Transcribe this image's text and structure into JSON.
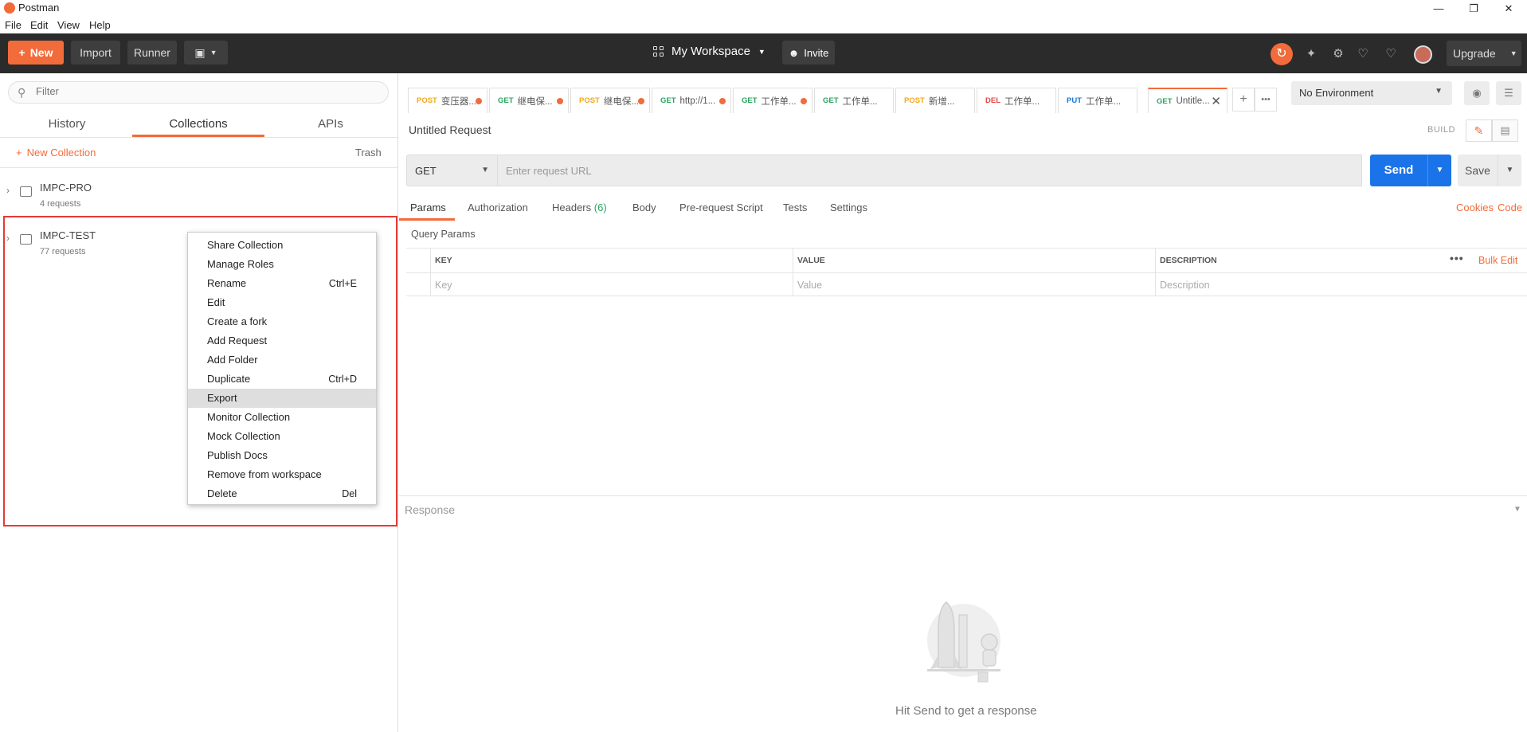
{
  "window": {
    "title": "Postman",
    "menu": [
      "File",
      "Edit",
      "View",
      "Help"
    ]
  },
  "header": {
    "new_label": "New",
    "import_label": "Import",
    "runner_label": "Runner",
    "workspace": "My Workspace",
    "invite_label": "Invite",
    "upgrade_label": "Upgrade"
  },
  "sidebar": {
    "filter_placeholder": "Filter",
    "tabs": [
      "History",
      "Collections",
      "APIs"
    ],
    "new_collection": "New Collection",
    "trash": "Trash",
    "collections": [
      {
        "name": "IMPC-PRO",
        "count": "4 requests"
      },
      {
        "name": "IMPC-TEST",
        "count": "77 requests"
      }
    ]
  },
  "context_menu": [
    {
      "label": "Share Collection",
      "shortcut": ""
    },
    {
      "label": "Manage Roles",
      "shortcut": ""
    },
    {
      "label": "Rename",
      "shortcut": "Ctrl+E"
    },
    {
      "label": "Edit",
      "shortcut": ""
    },
    {
      "label": "Create a fork",
      "shortcut": ""
    },
    {
      "label": "Add Request",
      "shortcut": ""
    },
    {
      "label": "Add Folder",
      "shortcut": ""
    },
    {
      "label": "Duplicate",
      "shortcut": "Ctrl+D"
    },
    {
      "label": "Export",
      "shortcut": ""
    },
    {
      "label": "Monitor Collection",
      "shortcut": ""
    },
    {
      "label": "Mock Collection",
      "shortcut": ""
    },
    {
      "label": "Publish Docs",
      "shortcut": ""
    },
    {
      "label": "Remove from workspace",
      "shortcut": ""
    },
    {
      "label": "Delete",
      "shortcut": "Del"
    }
  ],
  "request_tabs": [
    {
      "method": "POST",
      "title": "变压器..."
    },
    {
      "method": "GET",
      "title": "继电保..."
    },
    {
      "method": "POST",
      "title": "继电保..."
    },
    {
      "method": "GET",
      "title": "http://1..."
    },
    {
      "method": "GET",
      "title": "工作单..."
    },
    {
      "method": "GET",
      "title": "工作单..."
    },
    {
      "method": "POST",
      "title": "新增..."
    },
    {
      "method": "DEL",
      "title": "工作单..."
    },
    {
      "method": "PUT",
      "title": "工作单..."
    },
    {
      "method": "GET",
      "title": "Untitle..."
    }
  ],
  "environment": "No Environment",
  "request": {
    "name": "Untitled Request",
    "build_label": "BUILD",
    "method": "GET",
    "url_placeholder": "Enter request URL",
    "send_label": "Send",
    "save_label": "Save"
  },
  "param_tabs": {
    "params": "Params",
    "authorization": "Authorization",
    "headers": "Headers",
    "headers_count": "(6)",
    "body": "Body",
    "prerequest": "Pre-request Script",
    "tests": "Tests",
    "settings": "Settings",
    "cookies": "Cookies",
    "code": "Code"
  },
  "query_params": {
    "title": "Query Params",
    "columns": [
      "KEY",
      "VALUE",
      "DESCRIPTION"
    ],
    "placeholders": [
      "Key",
      "Value",
      "Description"
    ],
    "bulk_edit": "Bulk Edit"
  },
  "response": {
    "title": "Response",
    "hint": "Hit Send to get a response"
  },
  "colors": {
    "accent": "#f26b3a",
    "send": "#1a73e8",
    "header_bg": "#2b2b2b"
  }
}
